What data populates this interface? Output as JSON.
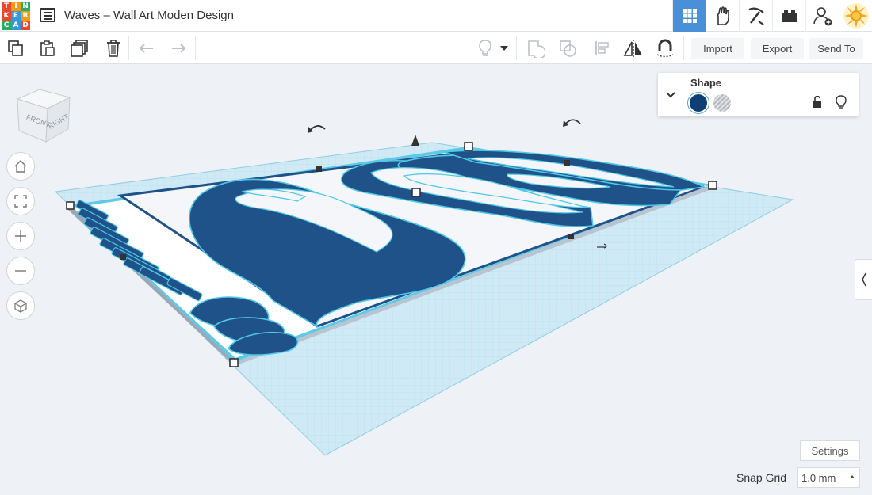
{
  "app": {
    "logo_letters": [
      "T",
      "I",
      "N",
      "K",
      "E",
      "R",
      "C",
      "A",
      "D"
    ],
    "logo_colors": [
      "#e8462d",
      "#f39c12",
      "#27ae60",
      "#e8462d",
      "#3498db",
      "#f39c12",
      "#27ae60",
      "#3498db",
      "#e8462d"
    ],
    "design_title": "Waves – Wall Art Moden Design"
  },
  "topnav": {
    "items": [
      {
        "icon": "grid-icon",
        "active": true
      },
      {
        "icon": "codeblocks-hand-icon",
        "active": false
      },
      {
        "icon": "pickaxe-icon",
        "active": false
      },
      {
        "icon": "bricks-icon",
        "active": false
      },
      {
        "icon": "add-user-icon",
        "active": false
      },
      {
        "icon": "avatar-sun-icon",
        "active": false
      }
    ]
  },
  "toolbar": {
    "icons": [
      "copy-icon",
      "paste-icon",
      "duplicate-icon",
      "delete-icon",
      "undo-icon",
      "redo-icon",
      "lightbulb-icon",
      "dropdown-arrow-icon",
      "group-icon",
      "ungroup-icon",
      "align-icon",
      "mirror-icon",
      "workplane-magnet-icon"
    ],
    "import_label": "Import",
    "export_label": "Export",
    "send_to_label": "Send To"
  },
  "inspector": {
    "title": "Shape",
    "solid_color": "#0d3f75",
    "icons": [
      "chevron-down-icon",
      "solid-swatch",
      "hole-swatch",
      "lock-icon",
      "lightbulb-icon"
    ]
  },
  "viewcube": {
    "front_label": "FRONT",
    "right_label": "RIGHT"
  },
  "nav_controls": [
    "home-view-icon",
    "fit-view-icon",
    "zoom-in-icon",
    "zoom-out-icon",
    "perspective-icon"
  ],
  "footer": {
    "settings_label": "Settings",
    "snap_grid_label": "Snap Grid",
    "snap_grid_value": "1.0 mm"
  },
  "colors": {
    "accent": "#4a90d9",
    "shape_fill": "#1f5289",
    "shape_edge": "#4fc7e6",
    "workplane": "#bfe3f0"
  }
}
